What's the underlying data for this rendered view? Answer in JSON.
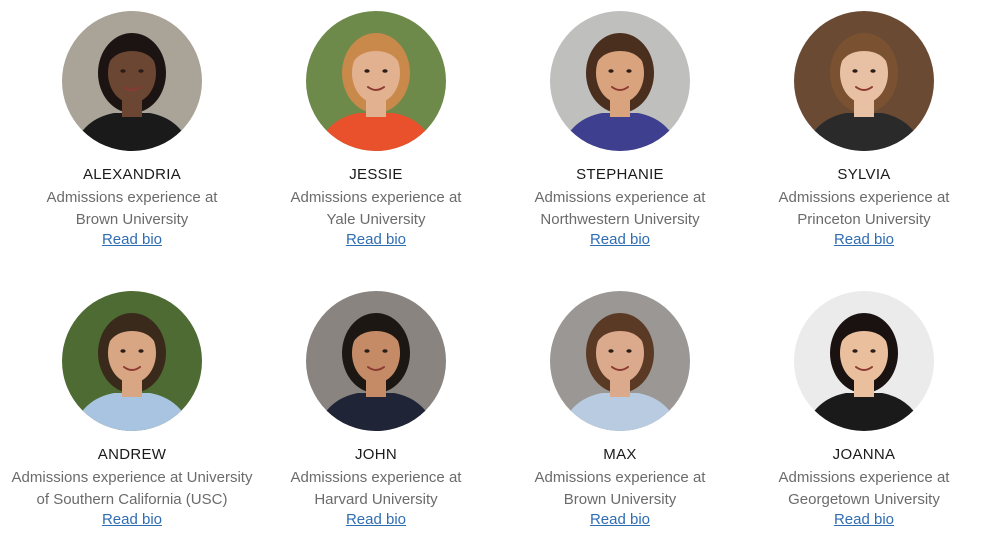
{
  "advisors": [
    {
      "name": "ALEXANDRIA",
      "line1": "Admissions experience at",
      "line2": "Brown University",
      "link": "Read bio",
      "bg": "#a9a398",
      "skin": "#6b4632",
      "hair": "#1c1412",
      "top": "#1a1a1a"
    },
    {
      "name": "JESSIE",
      "line1": "Admissions experience at",
      "line2": "Yale University",
      "link": "Read bio",
      "bg": "#6d8a4a",
      "skin": "#e2b18f",
      "hair": "#c8894a",
      "top": "#e8512c"
    },
    {
      "name": "STEPHANIE",
      "line1": "Admissions experience at",
      "line2": "Northwestern University",
      "link": "Read bio",
      "bg": "#bfbfbd",
      "skin": "#d9a37d",
      "hair": "#4a2e1e",
      "top": "#3e3f8f"
    },
    {
      "name": "SYLVIA",
      "line1": "Admissions experience at",
      "line2": "Princeton University",
      "link": "Read bio",
      "bg": "#6b4a34",
      "skin": "#e8c0a4",
      "hair": "#7a5232",
      "top": "#2a2a2a"
    },
    {
      "name": "ANDREW",
      "line1": "Admissions experience at University",
      "line2": "of Southern California (USC)",
      "link": "Read bio",
      "bg": "#4d6b32",
      "skin": "#d9a684",
      "hair": "#3a2a1c",
      "top": "#a9c4e0"
    },
    {
      "name": "JOHN",
      "line1": "Admissions experience at",
      "line2": "Harvard University",
      "link": "Read bio",
      "bg": "#8a8480",
      "skin": "#c48b66",
      "hair": "#1d1714",
      "top": "#1f2436"
    },
    {
      "name": "MAX",
      "line1": "Admissions experience at",
      "line2": "Brown University",
      "link": "Read bio",
      "bg": "#9a9794",
      "skin": "#dba98c",
      "hair": "#5a3a24",
      "top": "#b8cbe0"
    },
    {
      "name": "JOANNA",
      "line1": "Admissions experience at",
      "line2": "Georgetown University",
      "link": "Read bio",
      "bg": "#ebebeb",
      "skin": "#e9bf9e",
      "hair": "#1a1210",
      "top": "#1a1a1a"
    }
  ],
  "colors": {
    "link": "#2f6db3",
    "name": "#1a1a1a",
    "description": "#6b6b6b"
  }
}
